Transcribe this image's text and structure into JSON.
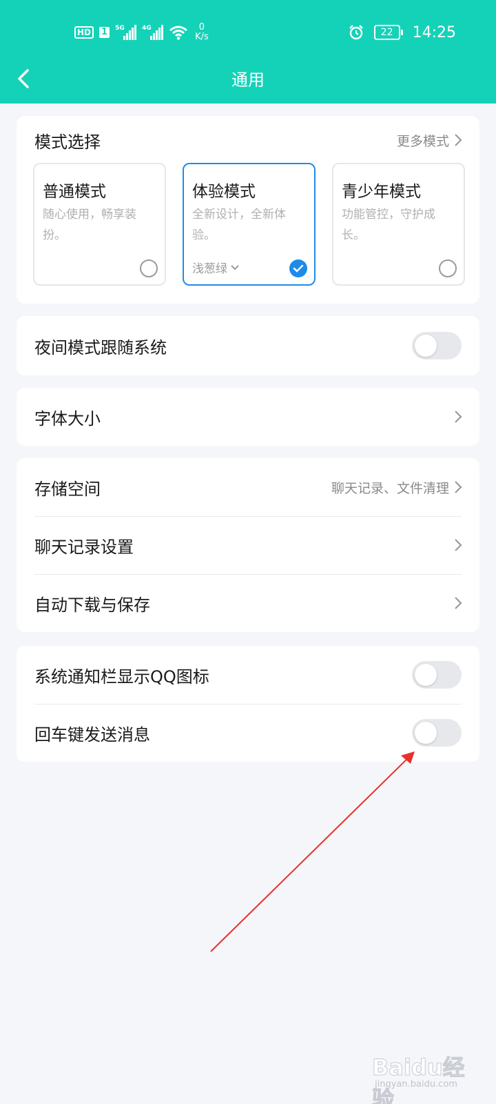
{
  "status_bar": {
    "hd": "HD",
    "sim": "1",
    "net1": "5G",
    "net2": "4G",
    "speed_value": "0",
    "speed_unit": "K/s",
    "battery": "22",
    "time": "14:25"
  },
  "header": {
    "title": "通用",
    "bg_color": "#14d2b8"
  },
  "mode_section": {
    "title": "模式选择",
    "more_label": "更多模式",
    "modes": [
      {
        "name": "普通模式",
        "desc": "随心使用，畅享装扮。",
        "selected": false
      },
      {
        "name": "体验模式",
        "desc": "全新设计，全新体验。",
        "selected": true,
        "theme": "浅葱绿"
      },
      {
        "name": "青少年模式",
        "desc": "功能管控，守护成长。",
        "selected": false
      }
    ]
  },
  "settings": {
    "night_mode": {
      "label": "夜间模式跟随系统",
      "on": false
    },
    "font_size": {
      "label": "字体大小"
    },
    "storage": {
      "label": "存储空间",
      "detail": "聊天记录、文件清理"
    },
    "chat_history": {
      "label": "聊天记录设置"
    },
    "auto_download": {
      "label": "自动下载与保存"
    },
    "notify_icon": {
      "label": "系统通知栏显示QQ图标",
      "on": false
    },
    "enter_send": {
      "label": "回车键发送消息",
      "on": false
    }
  },
  "annotation": {
    "color": "#e8312a",
    "icon": "red-arrow-icon"
  },
  "watermark": {
    "text": "Baidu经验",
    "sub": "jingyan.baidu.com"
  },
  "colors": {
    "accent": "#1e8be8",
    "background": "#f4f6fa"
  }
}
